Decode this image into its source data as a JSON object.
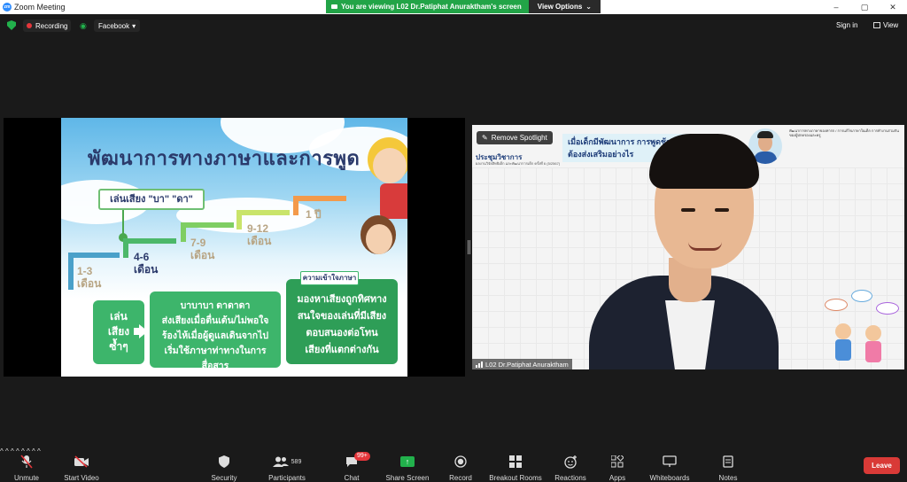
{
  "window": {
    "title": "Zoom Meeting",
    "app_icon": "zoom",
    "share_banner": "You are viewing L02 Dr.Patiphat Anuraktham's screen",
    "view_options": "View Options",
    "controls": [
      "–",
      "▢",
      "✕"
    ]
  },
  "topbar": {
    "recording_label": "Recording",
    "stream_label": "Facebook",
    "sign_in": "Sign in",
    "view_label": "View"
  },
  "slide": {
    "title": "พัฒนาการทางภาษาและการพูด",
    "baba_label": "เล่นเสียง \"บา\" \"ดา\"",
    "ages": [
      {
        "num": "1-3",
        "unit": "เดือน"
      },
      {
        "num": "4-6",
        "unit": "เดือน"
      },
      {
        "num": "7-9",
        "unit": "เดือน"
      },
      {
        "num": "9-12",
        "unit": "เดือน"
      },
      {
        "num": "1 ปี",
        "unit": ""
      }
    ],
    "box_repeat": "เล่น เสียง ซ้ำๆ",
    "box_babble_1": "บาบาบา ดาดาดา",
    "box_babble_2": "ส่งเสียงเมื่อตื่นเต้น/ไม่พอใจ",
    "box_babble_3": "ร้องไห้เมื่อผู้ดูแลเดินจากไป",
    "box_babble_4": "เริ่มใช้ภาษาท่าทางในการสื่อสาร",
    "tag_understand": "ความเข้าใจภาษา",
    "box_understand_1": "มองหาเสียงถูกทิศทาง",
    "box_understand_2": "สนใจของเล่นที่มีเสียง",
    "box_understand_3": "ตอบสนองต่อโทน",
    "box_understand_4": "เสียงที่แตกต่างกัน"
  },
  "camera": {
    "spotlight_button": "Remove Spotlight",
    "participant_name": "L02 Dr.Patiphat Anuraktham",
    "bg_slide_title_1": "เมื่อเด็กมีพัฒนาการ การพูดช้า",
    "bg_slide_title_2": "ต้องส่งเสริมอย่างไร",
    "bg_slide_left": "ประชุมวิชาการ",
    "bg_slide_small": "ผลงานวิจัยสิทธิเด็ก และพัฒนาการเด็ก ครั้งที่ 6 (5/2567)",
    "bg_right_text": "พัฒนาการทางภาษาของทารก / การแก้ไขภาษาในเด็ก การทำงานร่วมกันของผู้ปกครองและครู"
  },
  "toolbar": {
    "unmute": "Unmute",
    "start_video": "Start Video",
    "security": "Security",
    "participants": "Participants",
    "participants_count": "589",
    "chat": "Chat",
    "chat_badge": "99+",
    "share_screen": "Share Screen",
    "record": "Record",
    "breakout": "Breakout Rooms",
    "reactions": "Reactions",
    "apps": "Apps",
    "whiteboards": "Whiteboards",
    "notes": "Notes",
    "leave": "Leave"
  },
  "colors": {
    "accent_green": "#22b14c",
    "leave_red": "#d93a37",
    "slide_green": "#3db56b",
    "zoom_blue": "#2d8cff"
  }
}
